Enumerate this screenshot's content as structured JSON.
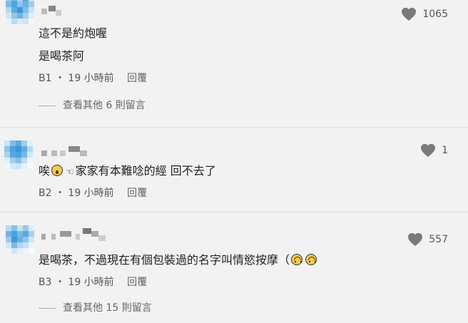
{
  "comments": [
    {
      "lines": [
        "這不是約炮喔",
        "是喝茶阿"
      ],
      "floor": "B1",
      "time": "19 小時前",
      "reply_label": "回覆",
      "likes": "1065",
      "more_replies": "查看其他 6 則留言"
    },
    {
      "line_parts": [
        "唉",
        "家家有本難唸的經 回不去了"
      ],
      "floor": "B2",
      "time": "19 小時前",
      "reply_label": "回覆",
      "likes": "1"
    },
    {
      "line_parts": [
        "是喝茶，不過現在有個包裝過的名字叫情慾按摩（"
      ],
      "floor": "B3",
      "time": "19 小時前",
      "reply_label": "回覆",
      "likes": "557",
      "more_replies": "查看其他 15 則留言"
    }
  ],
  "icons": {
    "like": "heart-icon",
    "wow_emoji": "surprised-face-icon",
    "pointing": "pointing-hand-icon",
    "upside": "upside-down-face-icon"
  },
  "colors": {
    "background": "#f2f2f2",
    "heart": "#7a7a7a",
    "avatar_blue": "#4aa3e0"
  }
}
